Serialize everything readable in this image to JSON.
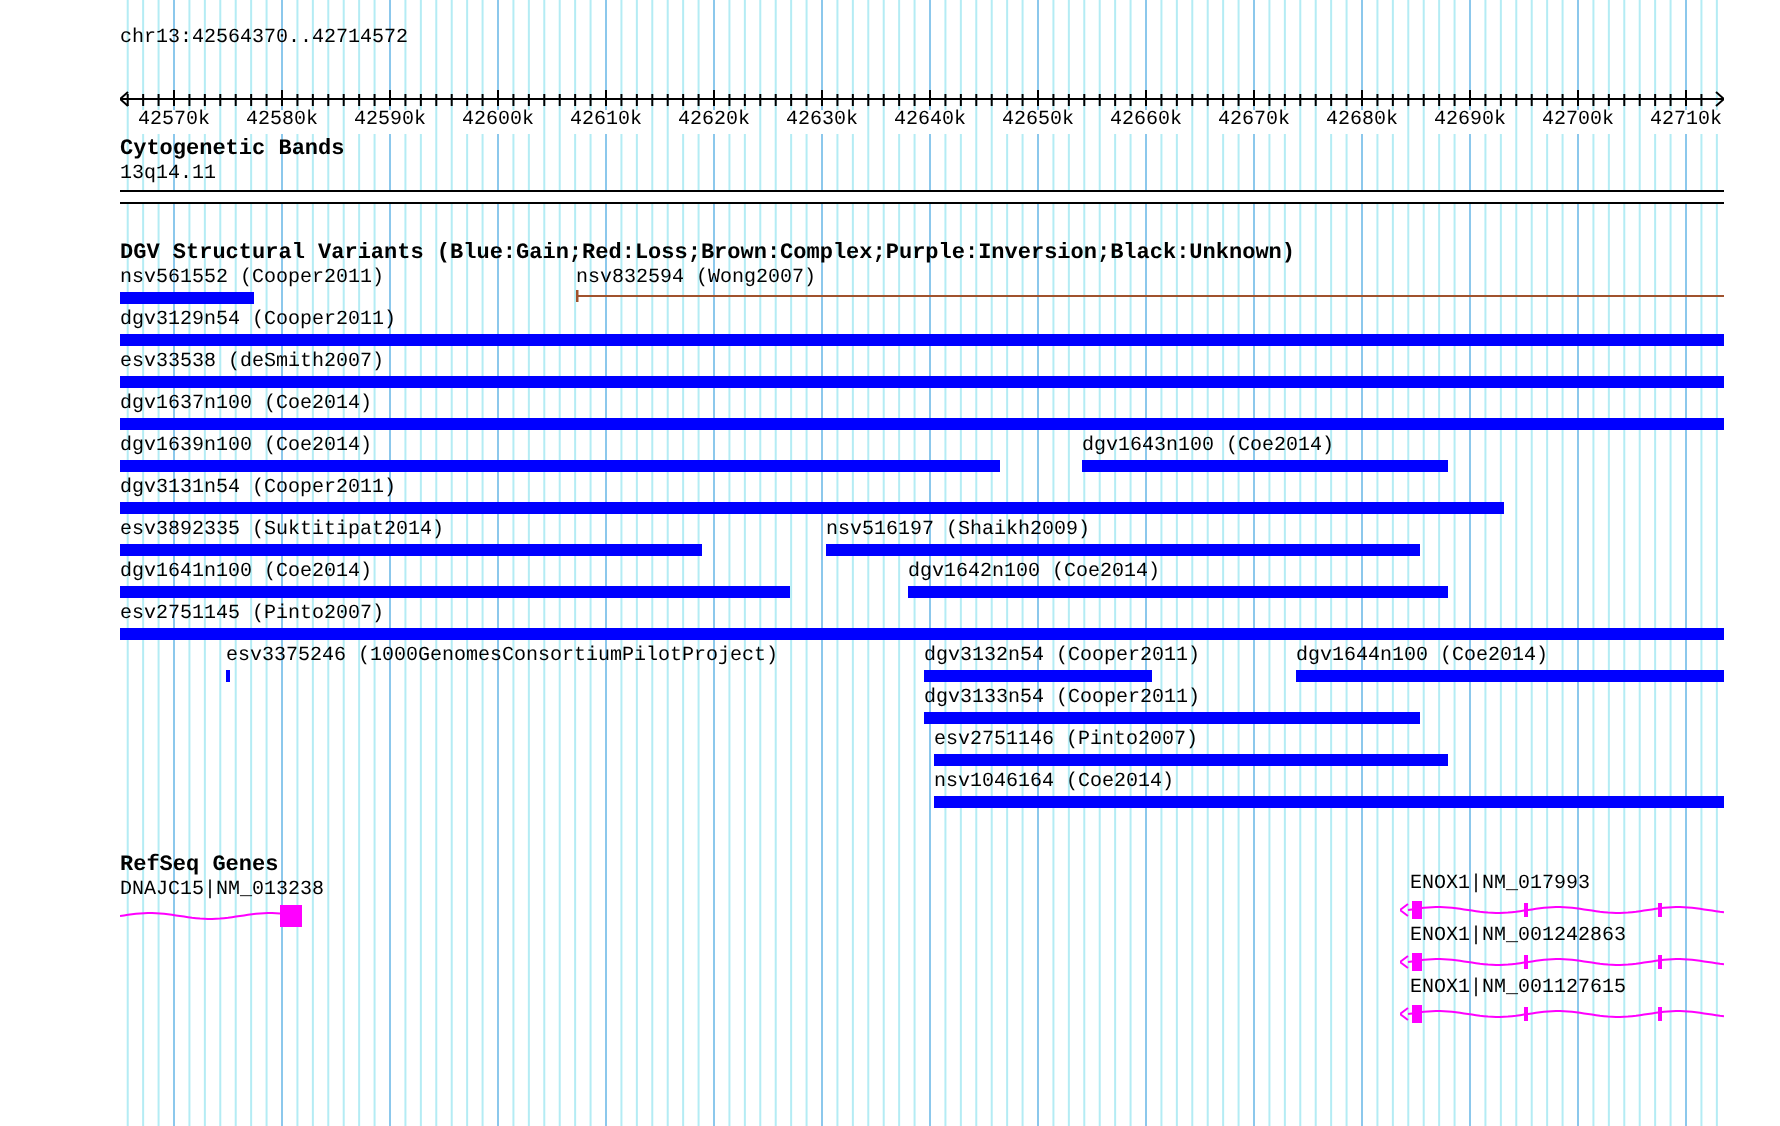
{
  "locator": {
    "text": "chr13:42564370..42714572"
  },
  "ruler": {
    "labels": [
      "42570k",
      "42580k",
      "42590k",
      "42600k",
      "42610k",
      "42620k",
      "42630k",
      "42640k",
      "42650k",
      "42660k",
      "42670k",
      "42680k",
      "42690k",
      "42700k",
      "42710k"
    ]
  },
  "tracks": [
    {
      "kind": "cytoband",
      "title": "Cytogenetic Bands",
      "bands": [
        {
          "label": "13q14.11"
        }
      ]
    },
    {
      "kind": "variants",
      "title": "DGV Structural Variants (Blue:Gain;Red:Loss;Brown:Complex;Purple:Inversion;Black:Unknown)",
      "rows": [
        {
          "features": [
            {
              "label": "nsv561552 (Cooper2011)",
              "color": "#0000ff",
              "kind": "bar"
            },
            {
              "label": "nsv832594 (Wong2007)",
              "color": "#a0522d",
              "kind": "line"
            }
          ]
        },
        {
          "features": [
            {
              "label": "dgv3129n54 (Cooper2011)",
              "color": "#0000ff",
              "kind": "bar"
            }
          ]
        },
        {
          "features": [
            {
              "label": "esv33538 (deSmith2007)",
              "color": "#0000ff",
              "kind": "bar"
            }
          ]
        },
        {
          "features": [
            {
              "label": "dgv1637n100 (Coe2014)",
              "color": "#0000ff",
              "kind": "bar"
            }
          ]
        },
        {
          "features": [
            {
              "label": "dgv1639n100 (Coe2014)",
              "color": "#0000ff",
              "kind": "bar"
            },
            {
              "label": "dgv1643n100 (Coe2014)",
              "color": "#0000ff",
              "kind": "bar"
            }
          ]
        },
        {
          "features": [
            {
              "label": "dgv3131n54 (Cooper2011)",
              "color": "#0000ff",
              "kind": "bar"
            }
          ]
        },
        {
          "features": [
            {
              "label": "esv3892335 (Suktitipat2014)",
              "color": "#0000ff",
              "kind": "bar"
            },
            {
              "label": "nsv516197 (Shaikh2009)",
              "color": "#0000ff",
              "kind": "bar"
            }
          ]
        },
        {
          "features": [
            {
              "label": "dgv1641n100 (Coe2014)",
              "color": "#0000ff",
              "kind": "bar"
            },
            {
              "label": "dgv1642n100 (Coe2014)",
              "color": "#0000ff",
              "kind": "bar"
            }
          ]
        },
        {
          "features": [
            {
              "label": "esv2751145 (Pinto2007)",
              "color": "#0000ff",
              "kind": "bar"
            }
          ]
        },
        {
          "features": [
            {
              "label": "esv3375246 (1000GenomesConsortiumPilotProject)",
              "color": "#0000ff",
              "kind": "bar"
            },
            {
              "label": "dgv3132n54 (Cooper2011)",
              "color": "#0000ff",
              "kind": "bar"
            },
            {
              "label": "dgv1644n100 (Coe2014)",
              "color": "#0000ff",
              "kind": "bar"
            }
          ]
        },
        {
          "features": [
            {
              "label": "dgv3133n54 (Cooper2011)",
              "color": "#0000ff",
              "kind": "bar"
            }
          ]
        },
        {
          "features": [
            {
              "label": "esv2751146 (Pinto2007)",
              "color": "#0000ff",
              "kind": "bar"
            }
          ]
        },
        {
          "features": [
            {
              "label": "nsv1046164 (Coe2014)",
              "color": "#0000ff",
              "kind": "bar"
            }
          ]
        }
      ]
    },
    {
      "kind": "genes",
      "title": "RefSeq Genes",
      "genes": [
        {
          "label": "DNAJC15|NM_013238",
          "reverse": false
        },
        {
          "label": "ENOX1|NM_017993",
          "reverse": true
        },
        {
          "label": "ENOX1|NM_001242863",
          "reverse": true
        },
        {
          "label": "ENOX1|NM_001127615",
          "reverse": true
        }
      ]
    }
  ]
}
